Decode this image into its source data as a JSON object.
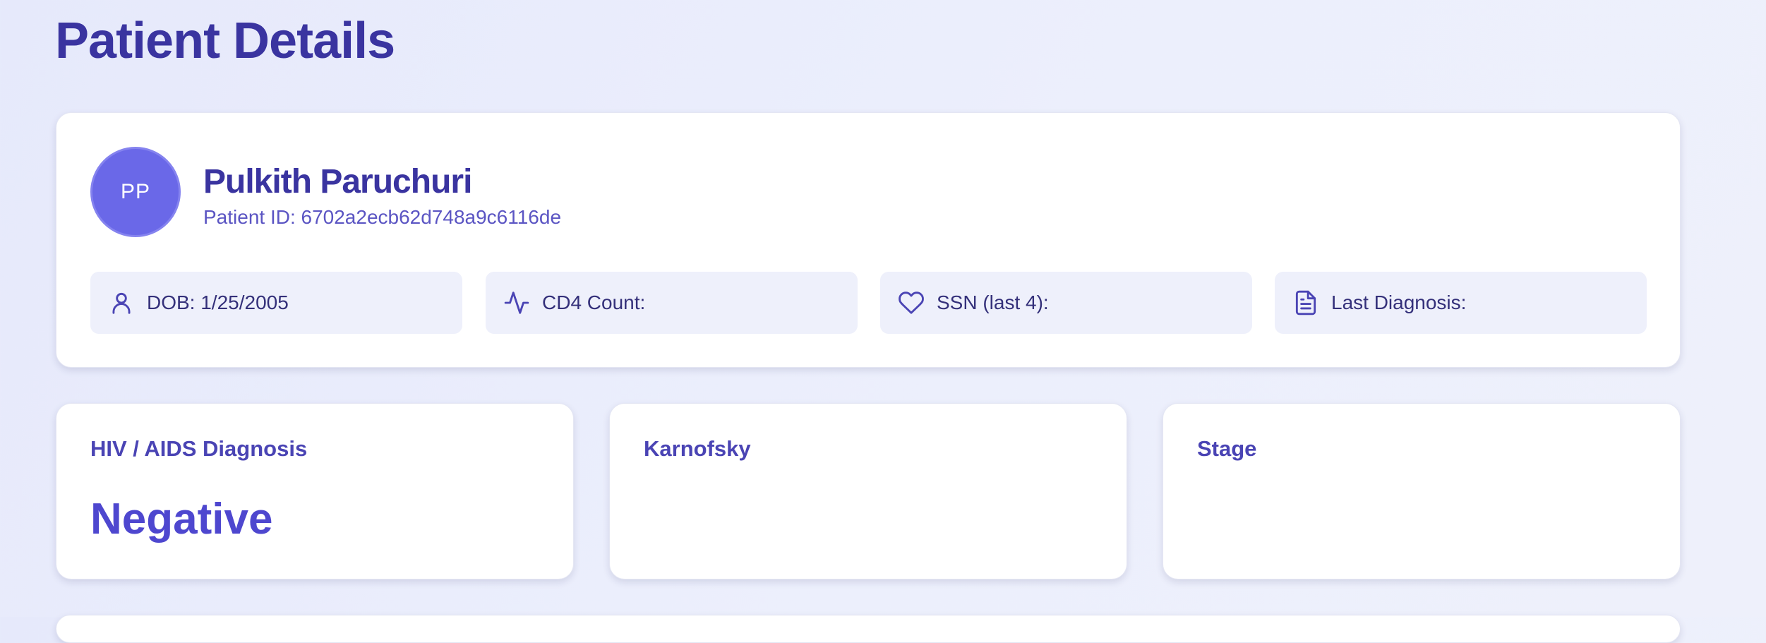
{
  "page": {
    "title": "Patient Details"
  },
  "patient": {
    "initials": "PP",
    "name": "Pulkith Paruchuri",
    "id_text": "Patient ID: 6702a2ecb62d748a9c6116de"
  },
  "info_tiles": [
    {
      "icon": "user-icon",
      "text": "DOB: 1/25/2005"
    },
    {
      "icon": "activity-icon",
      "text": "CD4 Count:"
    },
    {
      "icon": "heart-icon",
      "text": "SSN (last 4):"
    },
    {
      "icon": "file-text-icon",
      "text": "Last Diagnosis:"
    }
  ],
  "metrics": [
    {
      "label": "HIV / AIDS Diagnosis",
      "value": "Negative"
    },
    {
      "label": "Karnofsky",
      "value": ""
    },
    {
      "label": "Stage",
      "value": ""
    }
  ],
  "colors": {
    "primary": "#3a34a0",
    "avatar": "#6a68e8",
    "tile_bg": "#eef0fb",
    "value_accent": "#4e47cf"
  }
}
